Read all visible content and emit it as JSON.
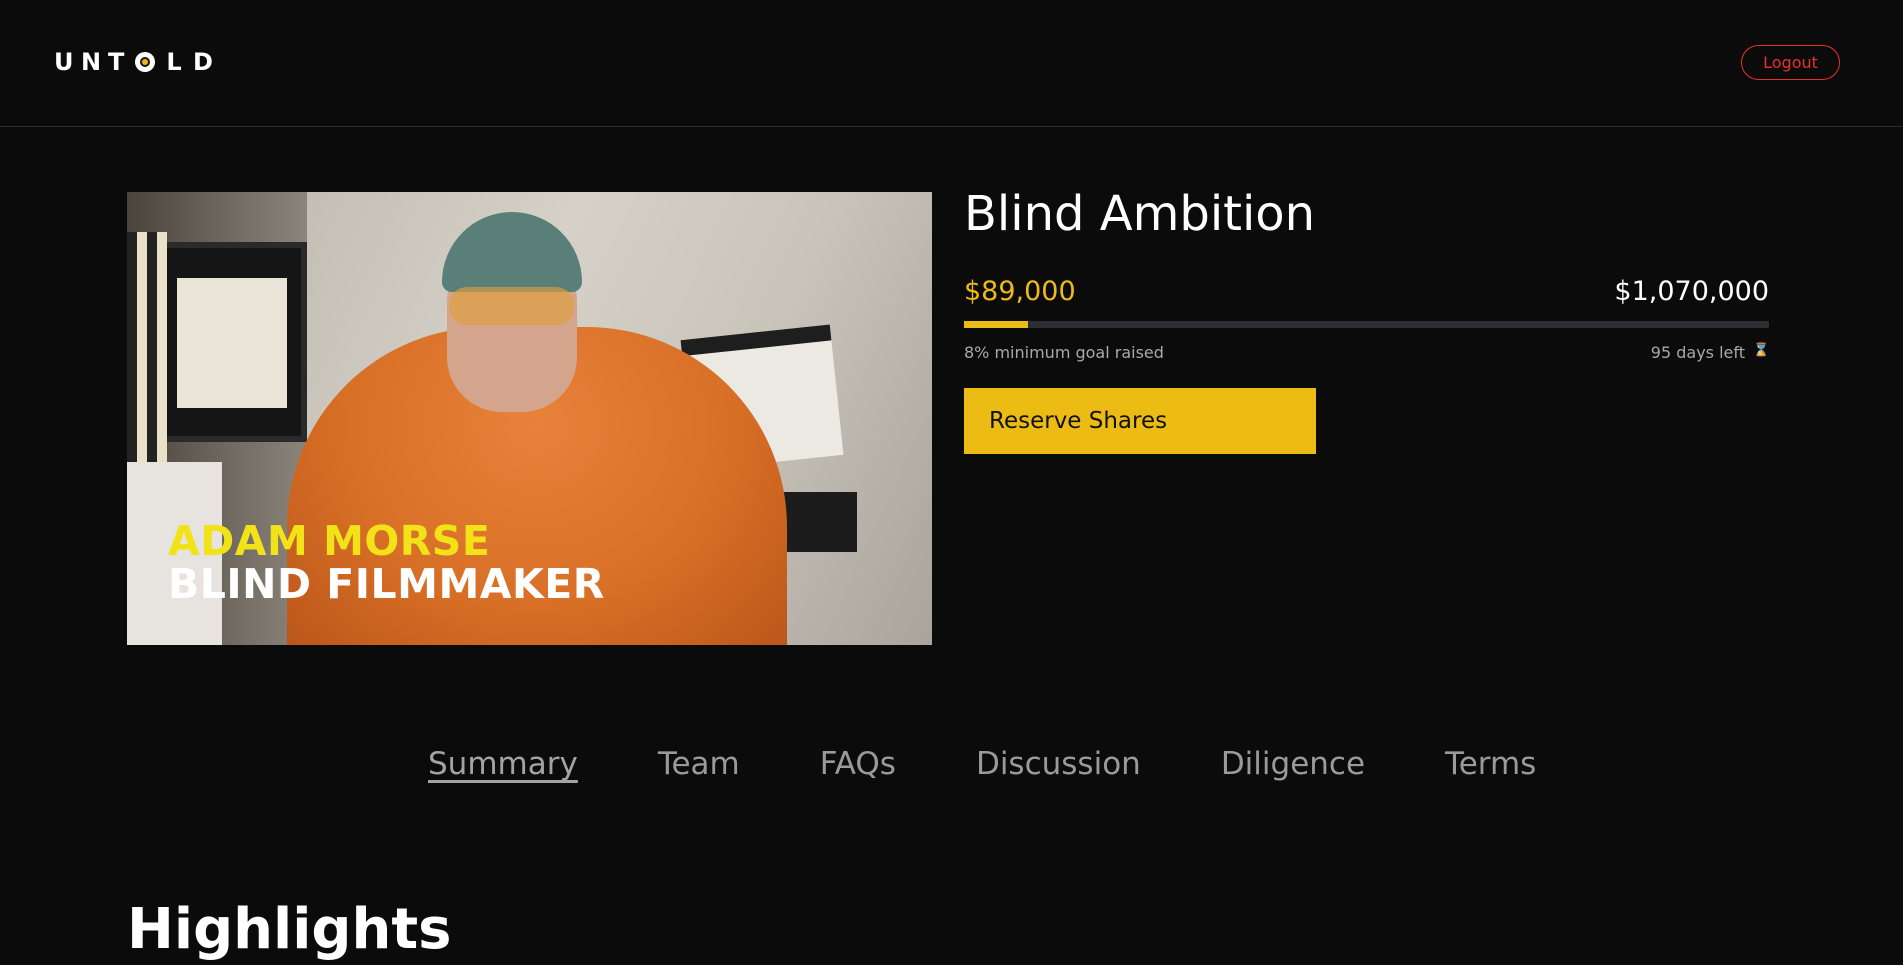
{
  "header": {
    "logo_letters": [
      "U",
      "N",
      "T",
      "",
      "L",
      "D"
    ],
    "logout_label": "Logout"
  },
  "media": {
    "caption_line1": "ADAM MORSE",
    "caption_line2": "BLIND FILMMAKER"
  },
  "campaign": {
    "title": "Blind Ambition",
    "raised": "$89,000",
    "goal": "$1,070,000",
    "progress_percent": 8,
    "progress_label": "8% minimum goal raised",
    "days_left": "95 days left",
    "reserve_label": "Reserve Shares"
  },
  "tabs": [
    {
      "label": "Summary",
      "active": true
    },
    {
      "label": "Team",
      "active": false
    },
    {
      "label": "FAQs",
      "active": false
    },
    {
      "label": "Discussion",
      "active": false
    },
    {
      "label": "Diligence",
      "active": false
    },
    {
      "label": "Terms",
      "active": false
    }
  ],
  "section": {
    "highlights_title": "Highlights"
  },
  "icons": {
    "logo_eye": "eye-icon",
    "days": "hourglass-icon"
  },
  "colors": {
    "accent": "#ecbc14",
    "logout": "#e8312b",
    "background": "#0b0b0b"
  }
}
